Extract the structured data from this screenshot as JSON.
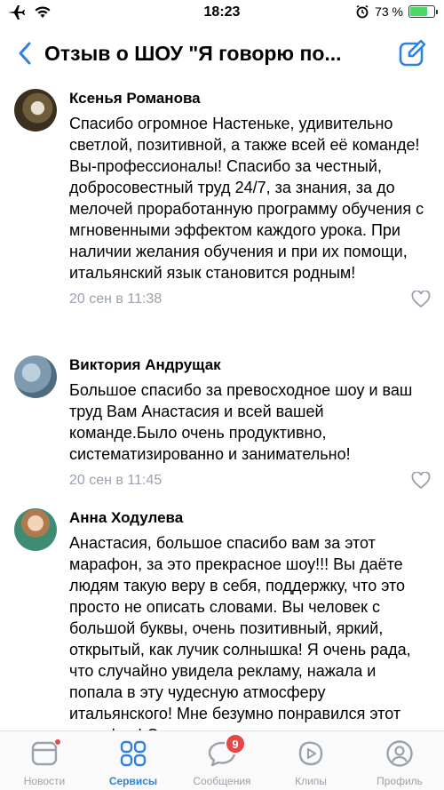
{
  "status_bar": {
    "time": "18:23",
    "battery_percent": "73 %",
    "battery_level": 0.73
  },
  "header": {
    "title": "Отзыв о ШОУ \"Я говорю по..."
  },
  "comments": [
    {
      "author": "Ксенья Романова",
      "text": "Спасибо огромное Настеньке, удивительно светлой, позитивной, а также всей её команде! Вы-профессионалы! Спасибо за честный, добросовестный труд 24/7, за знания, за до мелочей проработанную программу обучения с мгновенными эффектом каждого урока. При наличии желания обучения и при их помощи, итальянский язык становится родным!",
      "time": "20 сен в 11:38"
    },
    {
      "author": "Виктория Андрущак",
      "text": "Большое спасибо за превосходное шоу и ваш труд Вам Анастасия и всей вашей команде.Было очень продуктивно, систематизированно и занимательно!",
      "time": "20 сен в 11:45"
    },
    {
      "author": "Анна Ходулева",
      "text": "Анастасия, большое спасибо вам за этот марафон, за это прекрасное шоу!!! Вы даёте людям такую веру в себя, поддержку, что это просто не описать словами. Вы человек с большой буквы, очень позитивный, яркий, открытый, как лучик солнышка! Я очень рада, что случайно увидела рекламу, нажала и попала в эту чудесную атмосферу итальянского! Мне безумно понравился этот марафон! Он вдохновил меня и",
      "time": ""
    }
  ],
  "tabs": [
    {
      "label": "Новости",
      "icon": "news-icon",
      "active": false
    },
    {
      "label": "Сервисы",
      "icon": "services-icon",
      "active": true
    },
    {
      "label": "Сообщения",
      "icon": "messages-icon",
      "active": false,
      "badge": "9"
    },
    {
      "label": "Клипы",
      "icon": "clips-icon",
      "active": false
    },
    {
      "label": "Профиль",
      "icon": "profile-icon",
      "active": false
    }
  ],
  "colors": {
    "accent": "#2d81e0",
    "secondary_text": "#99a2ad",
    "badge": "#e64646",
    "battery": "#4cd964"
  }
}
